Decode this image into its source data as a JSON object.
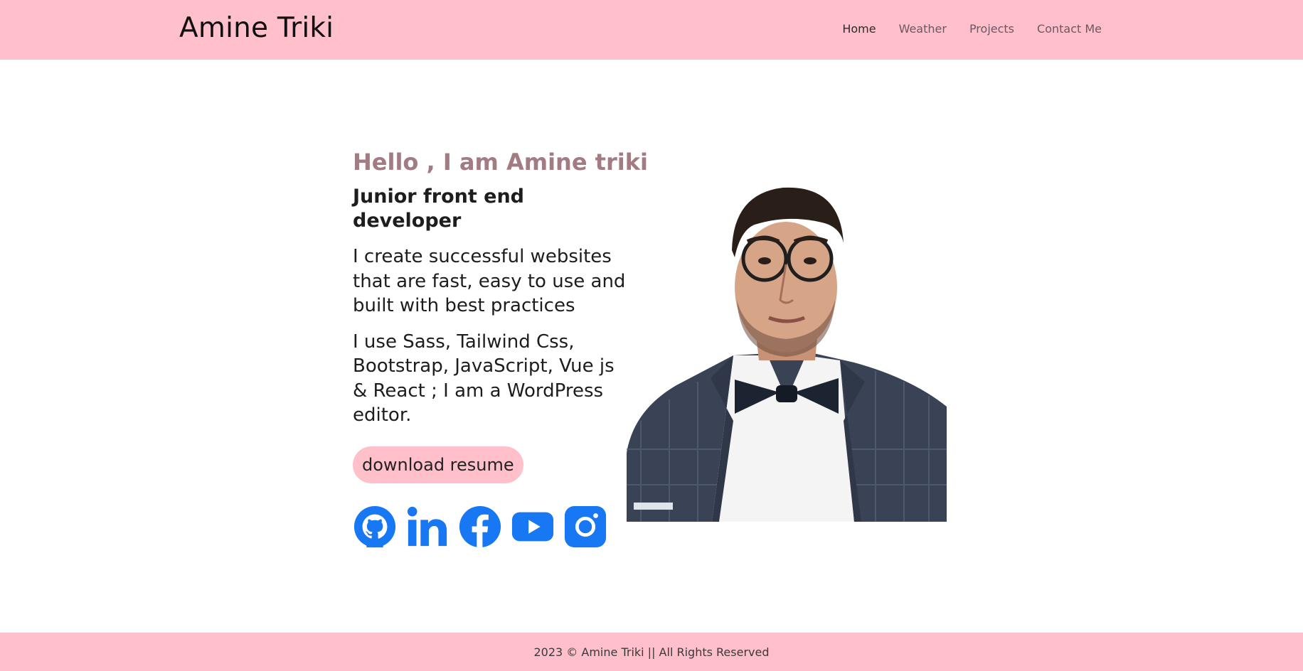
{
  "navbar": {
    "brand": "Amine Triki",
    "links": [
      "Home",
      "Weather",
      "Projects",
      "Contact Me"
    ],
    "active": "Home",
    "background": "#ffc0cb"
  },
  "hero": {
    "greeting": "Hello , I am Amine triki",
    "role": "Junior front end developer",
    "pitch": "I create successful websites that are fast, easy to use and built with best practices",
    "skills": "I use Sass, Tailwind Css, Bootstrap, JavaScript, Vue js & React ; I am a WordPress editor.",
    "resume_button": "download resume",
    "greeting_color": "#a37b82"
  },
  "socials": [
    {
      "name": "github",
      "icon": "github-icon"
    },
    {
      "name": "linkedin",
      "icon": "linkedin-icon"
    },
    {
      "name": "facebook",
      "icon": "facebook-icon"
    },
    {
      "name": "youtube",
      "icon": "youtube-icon"
    },
    {
      "name": "instagram",
      "icon": "instagram-icon"
    }
  ],
  "social_icon_color": "#1877f2",
  "portrait": {
    "icon": "profile-photo"
  },
  "footer": {
    "text": "2023 © Amine Triki || All Rights Reserved"
  }
}
